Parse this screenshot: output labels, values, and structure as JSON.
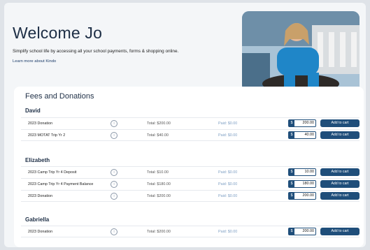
{
  "welcome": {
    "title": "Welcome Jo",
    "subtitle": "Simplify school life by accessing all your school payments, forms & shopping online.",
    "link": "Learn more about Kindo"
  },
  "fees": {
    "heading": "Fees and Donations",
    "students": [
      {
        "name": "David",
        "items": [
          {
            "name": "2023 Donation",
            "total": "Total:  $200.00",
            "paid": "Paid:  $0.00",
            "amount": "200.00",
            "button": "Add to cart"
          },
          {
            "name": "2023 MOTAT Trip Yr 2",
            "total": "Total:  $40.00",
            "paid": "Paid:  $0.00",
            "amount": "40.00",
            "button": "Add to cart"
          }
        ]
      },
      {
        "name": "Elizabeth",
        "items": [
          {
            "name": "2023 Camp Trip Yr 4 Deposit",
            "total": "Total:  $10.00",
            "paid": "Paid:  $0.00",
            "amount": "10.00",
            "button": "Add to cart"
          },
          {
            "name": "2023 Camp Trip Yr 4 Payment Balance",
            "total": "Total:  $180.00",
            "paid": "Paid:  $0.00",
            "amount": "180.00",
            "button": "Add to cart"
          },
          {
            "name": "2023 Donation",
            "total": "Total:  $200.00",
            "paid": "Paid:  $0.00",
            "amount": "200.00",
            "button": "Add to cart"
          }
        ]
      },
      {
        "name": "Gabriella",
        "items": [
          {
            "name": "2023 Donation",
            "total": "Total:  $200.00",
            "paid": "Paid:  $0.00",
            "amount": "200.00",
            "button": "Add to cart"
          }
        ]
      }
    ]
  },
  "currency_symbol": "$",
  "colors": {
    "accent": "#1f4e7a",
    "paid_text": "#7fa0c4",
    "heading": "#1d2e45"
  }
}
